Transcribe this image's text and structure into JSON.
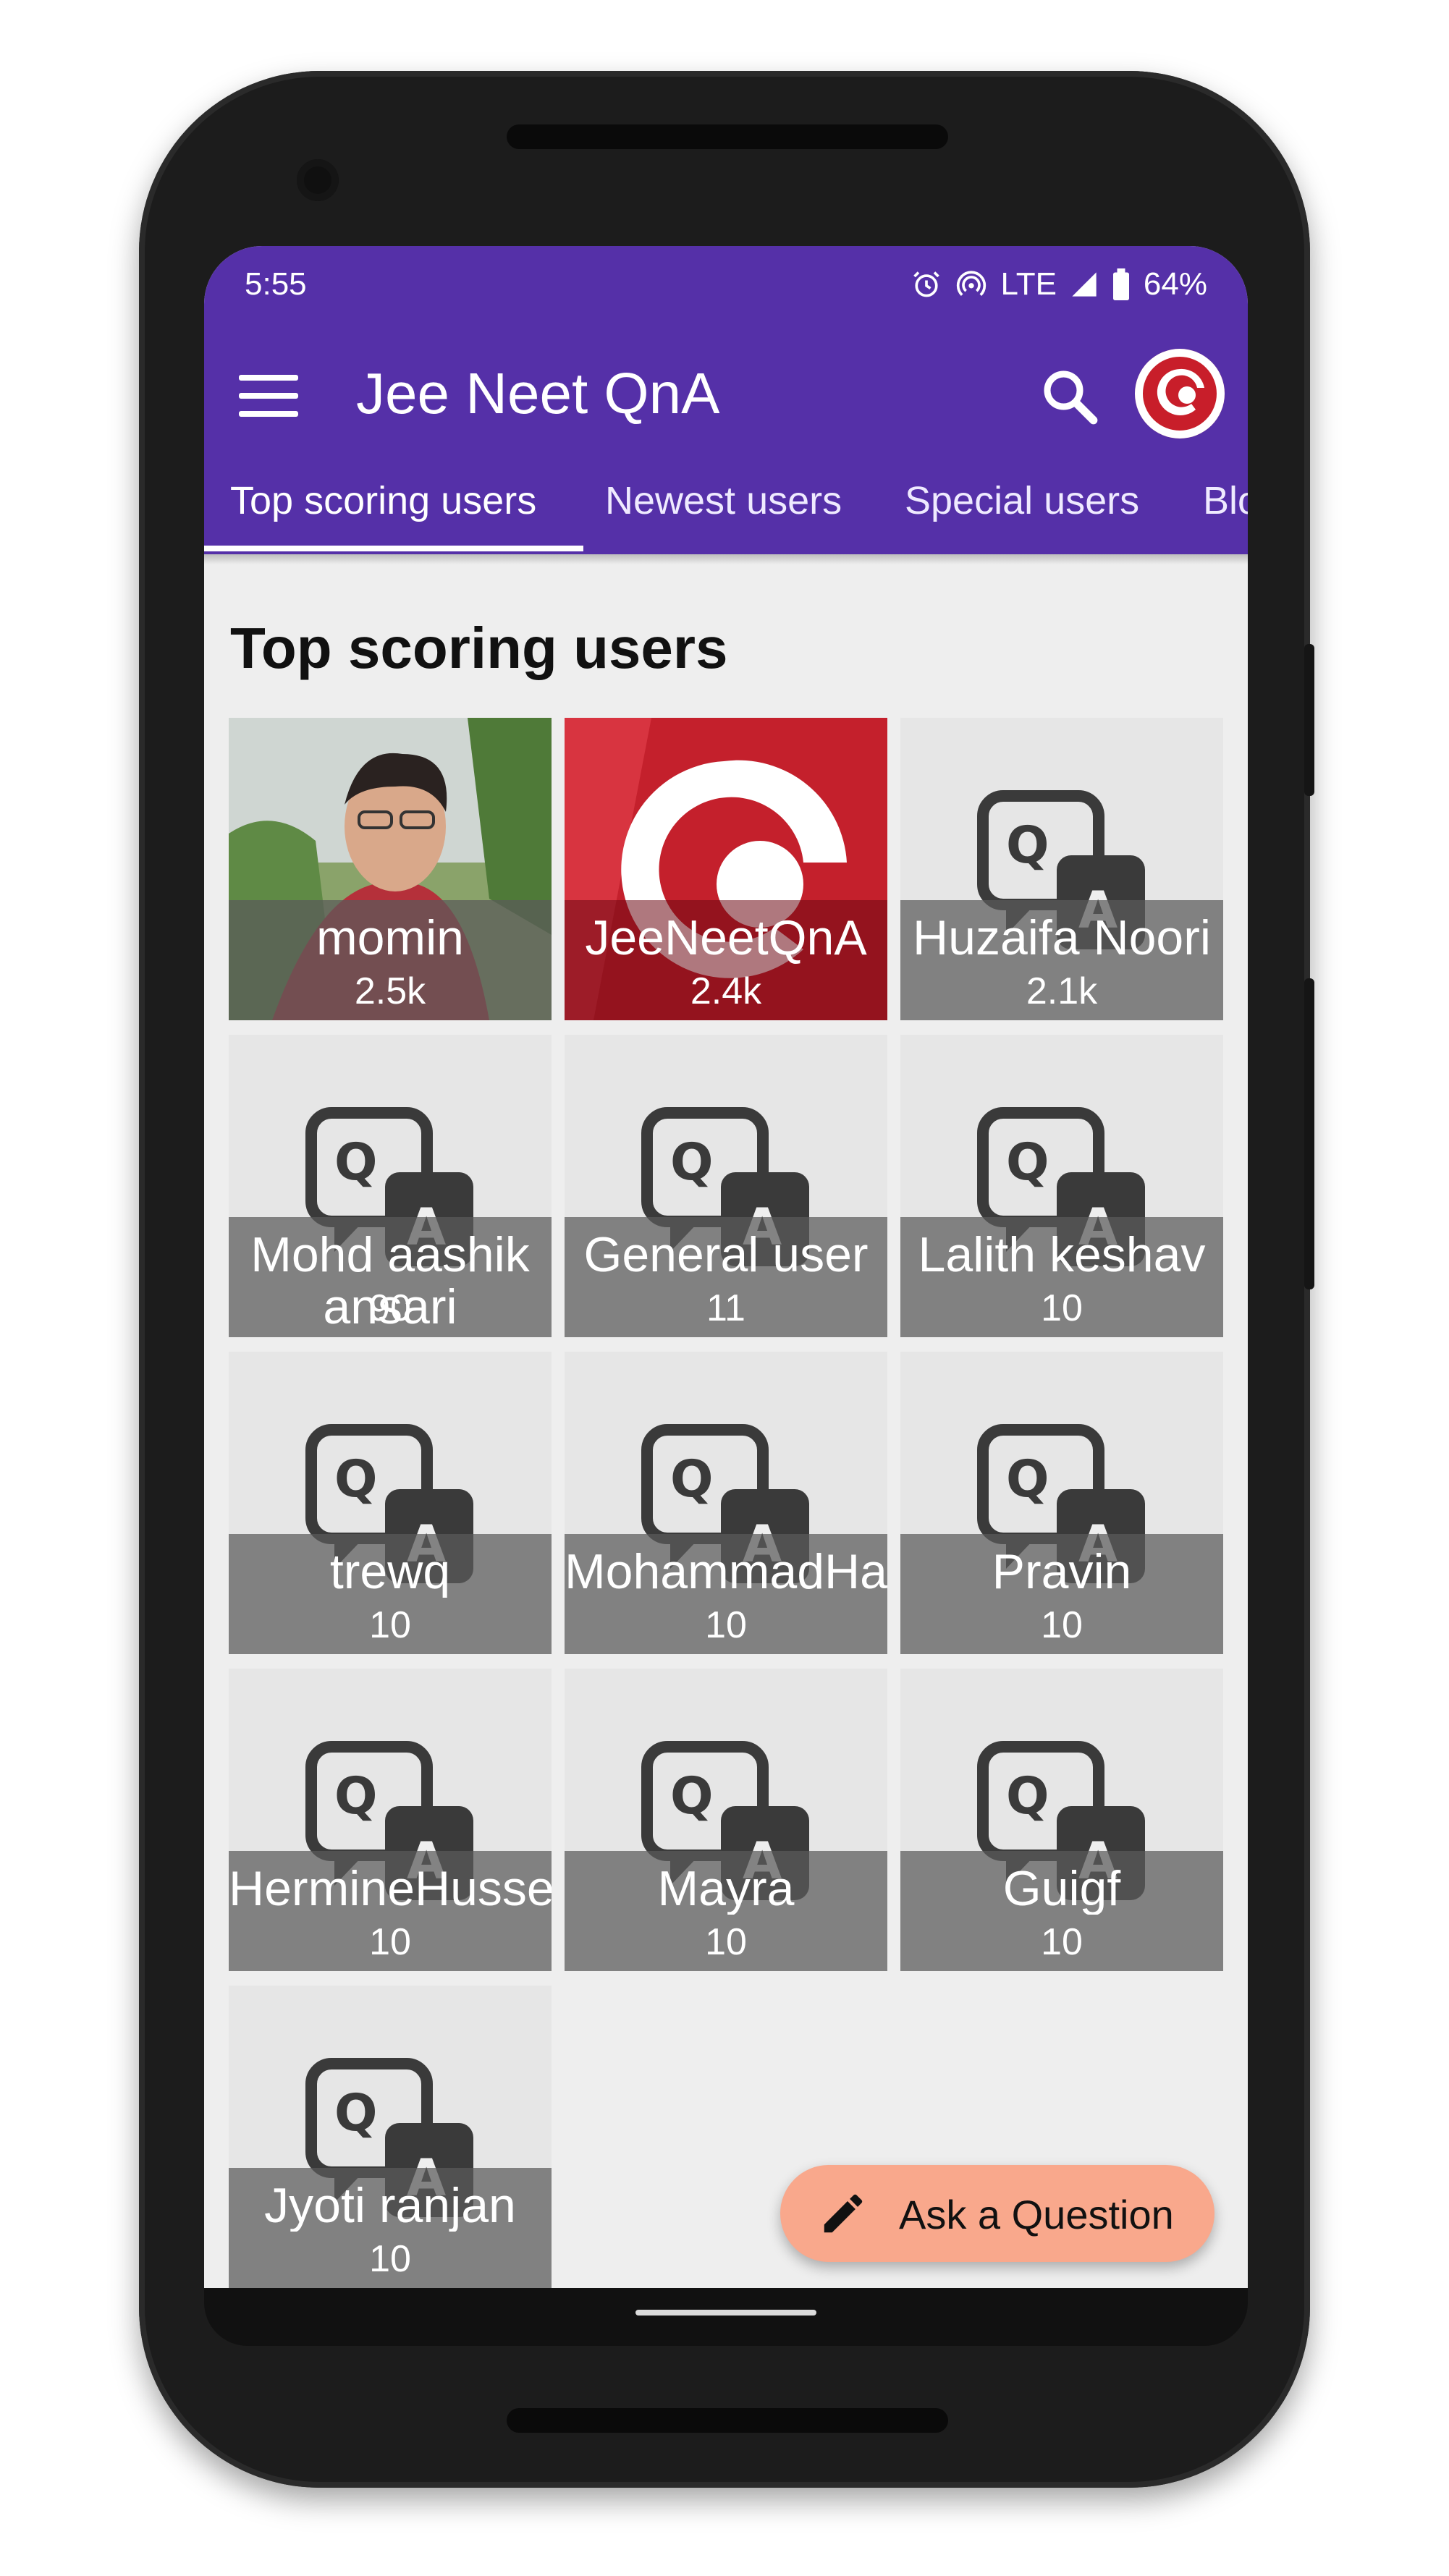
{
  "status_bar": {
    "time": "5:55",
    "network": "LTE",
    "battery": "64%"
  },
  "app_bar": {
    "title": "Jee Neet QnA",
    "menu_icon": "hamburger-menu-icon",
    "search_icon": "search-icon",
    "avatar_icon": "app-logo-icon"
  },
  "tabs": [
    {
      "label": "Top scoring users",
      "selected": true
    },
    {
      "label": "Newest users",
      "selected": false
    },
    {
      "label": "Special users",
      "selected": false
    },
    {
      "label": "Blo",
      "selected": false
    }
  ],
  "section_title": "Top scoring users",
  "users": [
    {
      "name": "momin",
      "score": "2.5k",
      "avatar": "photo"
    },
    {
      "name": "JeeNeetQnA",
      "score": "2.4k",
      "avatar": "brand"
    },
    {
      "name": "Huzaifa Noori",
      "score": "2.1k",
      "avatar": "qa-default"
    },
    {
      "name": "Mohd aashik ansari",
      "score": "90",
      "avatar": "qa-default"
    },
    {
      "name": "General user",
      "score": "11",
      "avatar": "qa-default"
    },
    {
      "name": "Lalith keshav",
      "score": "10",
      "avatar": "qa-default"
    },
    {
      "name": "trewq",
      "score": "10",
      "avatar": "qa-default"
    },
    {
      "name": "MohammadHa",
      "score": "10",
      "avatar": "qa-default"
    },
    {
      "name": "Pravin",
      "score": "10",
      "avatar": "qa-default"
    },
    {
      "name": "HermineHusse",
      "score": "10",
      "avatar": "qa-default"
    },
    {
      "name": "Mayra",
      "score": "10",
      "avatar": "qa-default"
    },
    {
      "name": "Guigf",
      "score": "10",
      "avatar": "qa-default"
    },
    {
      "name": "Jyoti ranjan",
      "score": "10",
      "avatar": "qa-default"
    }
  ],
  "fab": {
    "label": "Ask a Question",
    "icon": "pencil-icon"
  },
  "colors": {
    "primary": "#5530a8",
    "fab": "#f9a88c",
    "brand_red": "#c81e2a"
  }
}
